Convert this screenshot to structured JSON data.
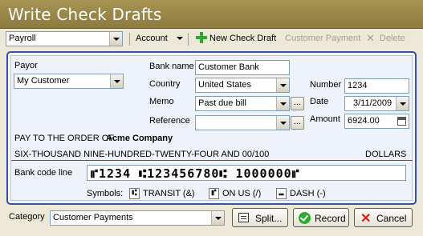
{
  "window": {
    "title": "Write Check Drafts"
  },
  "toolbar": {
    "account_select": "Payroll",
    "account_menu": "Account",
    "new_check_draft": "New Check Draft",
    "customer_payment": "Customer Payment",
    "delete": "Delete"
  },
  "check": {
    "payor_label": "Payor",
    "payor_value": "My Customer",
    "bank_name_label": "Bank name",
    "bank_name_value": "Customer Bank",
    "country_label": "Country",
    "country_value": "United States",
    "memo_label": "Memo",
    "memo_value": "Past due bill",
    "reference_label": "Reference",
    "reference_value": "",
    "number_label": "Number",
    "number_value": "1234",
    "date_label": "Date",
    "date_value": "3/11/2009",
    "amount_label": "Amount",
    "amount_value": "6924.00",
    "pay_to_label": "PAY TO THE ORDER OF",
    "pay_to_value": "Acme Company",
    "amount_words": "SIX-THOUSAND NINE-HUNDRED-TWENTY-FOUR AND 00/100",
    "dollars_label": "DOLLARS",
    "bank_code_label": "Bank code line",
    "bank_code_value": "⑈1234 ⑆123456780⑆ 1000000⑈",
    "symbols_label": "Symbols:",
    "symbol_transit": "TRANSIT (&)",
    "symbol_on_us": "ON US (/)",
    "symbol_dash": "DASH (-)"
  },
  "footer": {
    "category_label": "Category",
    "category_value": "Customer Payments",
    "split_button": "Split...",
    "record_button": "Record",
    "cancel_button": "Cancel"
  }
}
